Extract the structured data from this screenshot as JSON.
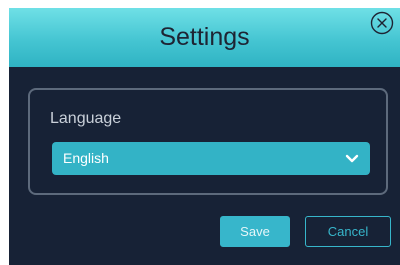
{
  "dialog": {
    "title": "Settings",
    "close_icon": "close-circle-icon"
  },
  "language": {
    "label": "Language",
    "selected_value": "English",
    "dropdown_icon": "chevron-down-icon"
  },
  "actions": {
    "save_label": "Save",
    "cancel_label": "Cancel"
  },
  "colors": {
    "header_gradient_top": "#6fe0e6",
    "header_gradient_bottom": "#2fb3c3",
    "dialog_background": "#172236",
    "accent": "#37b6cb",
    "panel_border": "#5d6a7c"
  }
}
